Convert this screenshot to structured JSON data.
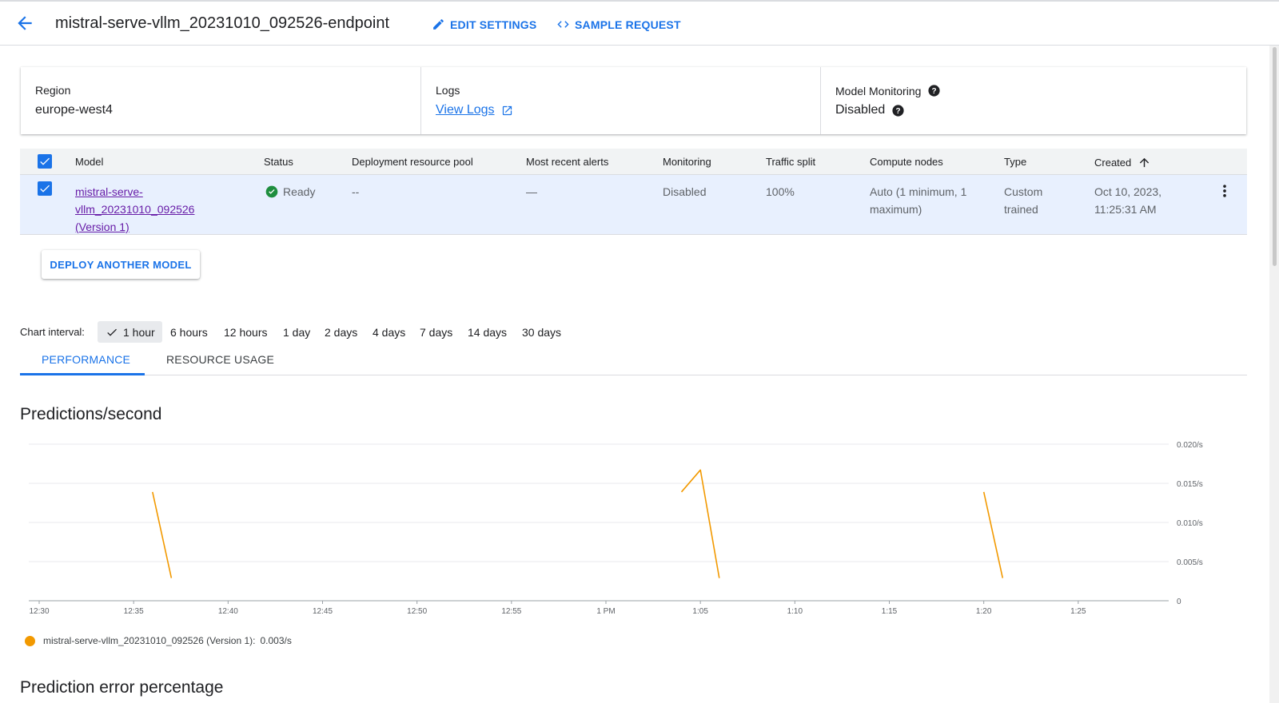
{
  "header": {
    "title": "mistral-serve-vllm_20231010_092526-endpoint",
    "edit_settings": "EDIT SETTINGS",
    "sample_request": "SAMPLE REQUEST",
    "icons": {
      "back": "arrow-back-icon",
      "edit": "pencil-icon",
      "code": "code-icon"
    }
  },
  "info": {
    "region_label": "Region",
    "region_value": "europe-west4",
    "logs_label": "Logs",
    "logs_link": "View Logs",
    "monitoring_label": "Model Monitoring",
    "monitoring_value": "Disabled"
  },
  "table": {
    "columns": [
      "Model",
      "Status",
      "Deployment resource pool",
      "Most recent alerts",
      "Monitoring",
      "Traffic split",
      "Compute nodes",
      "Type",
      "Created"
    ],
    "sort_column": "Created",
    "sort_direction": "ascending",
    "rows": [
      {
        "checked": true,
        "model_lines": [
          "mistral-serve-",
          "vllm_20231010_092526",
          "(Version 1)"
        ],
        "status": "Ready",
        "pool": "--",
        "alerts": "—",
        "monitoring": "Disabled",
        "traffic": "100%",
        "nodes_lines": [
          "Auto (1 minimum, 1",
          "maximum)"
        ],
        "type_lines": [
          "Custom",
          "trained"
        ],
        "created_lines": [
          "Oct 10, 2023,",
          "11:25:31 AM"
        ]
      }
    ]
  },
  "deploy_button": "DEPLOY ANOTHER MODEL",
  "chart_interval": {
    "label": "Chart interval:",
    "options": [
      "1 hour",
      "6 hours",
      "12 hours",
      "1 day",
      "2 days",
      "4 days",
      "7 days",
      "14 days",
      "30 days"
    ],
    "selected": "1 hour"
  },
  "tabs": {
    "performance": "PERFORMANCE",
    "resource_usage": "RESOURCE USAGE",
    "active": "PERFORMANCE"
  },
  "sections": {
    "predictions_title": "Predictions/second",
    "errors_title": "Prediction error percentage"
  },
  "colors": {
    "accent": "#1a73e8",
    "series": "#f29900",
    "status_ok": "#1e8e3e",
    "visited_link": "#681da8"
  },
  "chart_data": {
    "type": "line",
    "title": "Predictions/second",
    "x_ticks": [
      "12:30",
      "12:35",
      "12:40",
      "12:45",
      "12:50",
      "12:55",
      "1 PM",
      "1:05",
      "1:10",
      "1:15",
      "1:20",
      "1:25"
    ],
    "x_range_minutes": [
      0,
      60
    ],
    "y_ticks": [
      "0",
      "0.005/s",
      "0.010/s",
      "0.015/s",
      "0.020/s"
    ],
    "ylim": [
      0,
      0.02
    ],
    "grid": true,
    "legend_position": "bottom-left",
    "series": [
      {
        "name": "mistral-serve-vllm_20231010_092526 (Version 1)",
        "legend_value": "0.003/s",
        "segments": [
          [
            {
              "x": "12:36",
              "y": 0.0139
            },
            {
              "x": "12:37",
              "y": 0.0029
            }
          ],
          [
            {
              "x": "1:04",
              "y": 0.0139
            },
            {
              "x": "1:05",
              "y": 0.0167
            },
            {
              "x": "1:06",
              "y": 0.0029
            }
          ],
          [
            {
              "x": "1:20",
              "y": 0.0139
            },
            {
              "x": "1:21",
              "y": 0.0029
            }
          ]
        ]
      }
    ]
  }
}
